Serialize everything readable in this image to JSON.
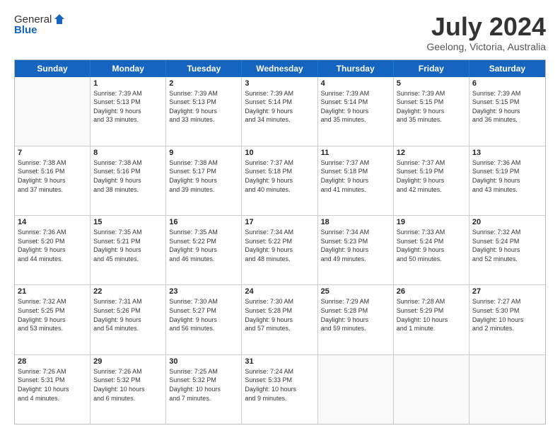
{
  "header": {
    "logo_general": "General",
    "logo_blue": "Blue",
    "month_title": "July 2024",
    "location": "Geelong, Victoria, Australia"
  },
  "days_of_week": [
    "Sunday",
    "Monday",
    "Tuesday",
    "Wednesday",
    "Thursday",
    "Friday",
    "Saturday"
  ],
  "weeks": [
    [
      {
        "day": "",
        "lines": []
      },
      {
        "day": "1",
        "lines": [
          "Sunrise: 7:39 AM",
          "Sunset: 5:13 PM",
          "Daylight: 9 hours",
          "and 33 minutes."
        ]
      },
      {
        "day": "2",
        "lines": [
          "Sunrise: 7:39 AM",
          "Sunset: 5:13 PM",
          "Daylight: 9 hours",
          "and 33 minutes."
        ]
      },
      {
        "day": "3",
        "lines": [
          "Sunrise: 7:39 AM",
          "Sunset: 5:14 PM",
          "Daylight: 9 hours",
          "and 34 minutes."
        ]
      },
      {
        "day": "4",
        "lines": [
          "Sunrise: 7:39 AM",
          "Sunset: 5:14 PM",
          "Daylight: 9 hours",
          "and 35 minutes."
        ]
      },
      {
        "day": "5",
        "lines": [
          "Sunrise: 7:39 AM",
          "Sunset: 5:15 PM",
          "Daylight: 9 hours",
          "and 35 minutes."
        ]
      },
      {
        "day": "6",
        "lines": [
          "Sunrise: 7:39 AM",
          "Sunset: 5:15 PM",
          "Daylight: 9 hours",
          "and 36 minutes."
        ]
      }
    ],
    [
      {
        "day": "7",
        "lines": [
          "Sunrise: 7:38 AM",
          "Sunset: 5:16 PM",
          "Daylight: 9 hours",
          "and 37 minutes."
        ]
      },
      {
        "day": "8",
        "lines": [
          "Sunrise: 7:38 AM",
          "Sunset: 5:16 PM",
          "Daylight: 9 hours",
          "and 38 minutes."
        ]
      },
      {
        "day": "9",
        "lines": [
          "Sunrise: 7:38 AM",
          "Sunset: 5:17 PM",
          "Daylight: 9 hours",
          "and 39 minutes."
        ]
      },
      {
        "day": "10",
        "lines": [
          "Sunrise: 7:37 AM",
          "Sunset: 5:18 PM",
          "Daylight: 9 hours",
          "and 40 minutes."
        ]
      },
      {
        "day": "11",
        "lines": [
          "Sunrise: 7:37 AM",
          "Sunset: 5:18 PM",
          "Daylight: 9 hours",
          "and 41 minutes."
        ]
      },
      {
        "day": "12",
        "lines": [
          "Sunrise: 7:37 AM",
          "Sunset: 5:19 PM",
          "Daylight: 9 hours",
          "and 42 minutes."
        ]
      },
      {
        "day": "13",
        "lines": [
          "Sunrise: 7:36 AM",
          "Sunset: 5:19 PM",
          "Daylight: 9 hours",
          "and 43 minutes."
        ]
      }
    ],
    [
      {
        "day": "14",
        "lines": [
          "Sunrise: 7:36 AM",
          "Sunset: 5:20 PM",
          "Daylight: 9 hours",
          "and 44 minutes."
        ]
      },
      {
        "day": "15",
        "lines": [
          "Sunrise: 7:35 AM",
          "Sunset: 5:21 PM",
          "Daylight: 9 hours",
          "and 45 minutes."
        ]
      },
      {
        "day": "16",
        "lines": [
          "Sunrise: 7:35 AM",
          "Sunset: 5:22 PM",
          "Daylight: 9 hours",
          "and 46 minutes."
        ]
      },
      {
        "day": "17",
        "lines": [
          "Sunrise: 7:34 AM",
          "Sunset: 5:22 PM",
          "Daylight: 9 hours",
          "and 48 minutes."
        ]
      },
      {
        "day": "18",
        "lines": [
          "Sunrise: 7:34 AM",
          "Sunset: 5:23 PM",
          "Daylight: 9 hours",
          "and 49 minutes."
        ]
      },
      {
        "day": "19",
        "lines": [
          "Sunrise: 7:33 AM",
          "Sunset: 5:24 PM",
          "Daylight: 9 hours",
          "and 50 minutes."
        ]
      },
      {
        "day": "20",
        "lines": [
          "Sunrise: 7:32 AM",
          "Sunset: 5:24 PM",
          "Daylight: 9 hours",
          "and 52 minutes."
        ]
      }
    ],
    [
      {
        "day": "21",
        "lines": [
          "Sunrise: 7:32 AM",
          "Sunset: 5:25 PM",
          "Daylight: 9 hours",
          "and 53 minutes."
        ]
      },
      {
        "day": "22",
        "lines": [
          "Sunrise: 7:31 AM",
          "Sunset: 5:26 PM",
          "Daylight: 9 hours",
          "and 54 minutes."
        ]
      },
      {
        "day": "23",
        "lines": [
          "Sunrise: 7:30 AM",
          "Sunset: 5:27 PM",
          "Daylight: 9 hours",
          "and 56 minutes."
        ]
      },
      {
        "day": "24",
        "lines": [
          "Sunrise: 7:30 AM",
          "Sunset: 5:28 PM",
          "Daylight: 9 hours",
          "and 57 minutes."
        ]
      },
      {
        "day": "25",
        "lines": [
          "Sunrise: 7:29 AM",
          "Sunset: 5:28 PM",
          "Daylight: 9 hours",
          "and 59 minutes."
        ]
      },
      {
        "day": "26",
        "lines": [
          "Sunrise: 7:28 AM",
          "Sunset: 5:29 PM",
          "Daylight: 10 hours",
          "and 1 minute."
        ]
      },
      {
        "day": "27",
        "lines": [
          "Sunrise: 7:27 AM",
          "Sunset: 5:30 PM",
          "Daylight: 10 hours",
          "and 2 minutes."
        ]
      }
    ],
    [
      {
        "day": "28",
        "lines": [
          "Sunrise: 7:26 AM",
          "Sunset: 5:31 PM",
          "Daylight: 10 hours",
          "and 4 minutes."
        ]
      },
      {
        "day": "29",
        "lines": [
          "Sunrise: 7:26 AM",
          "Sunset: 5:32 PM",
          "Daylight: 10 hours",
          "and 6 minutes."
        ]
      },
      {
        "day": "30",
        "lines": [
          "Sunrise: 7:25 AM",
          "Sunset: 5:32 PM",
          "Daylight: 10 hours",
          "and 7 minutes."
        ]
      },
      {
        "day": "31",
        "lines": [
          "Sunrise: 7:24 AM",
          "Sunset: 5:33 PM",
          "Daylight: 10 hours",
          "and 9 minutes."
        ]
      },
      {
        "day": "",
        "lines": []
      },
      {
        "day": "",
        "lines": []
      },
      {
        "day": "",
        "lines": []
      }
    ]
  ]
}
